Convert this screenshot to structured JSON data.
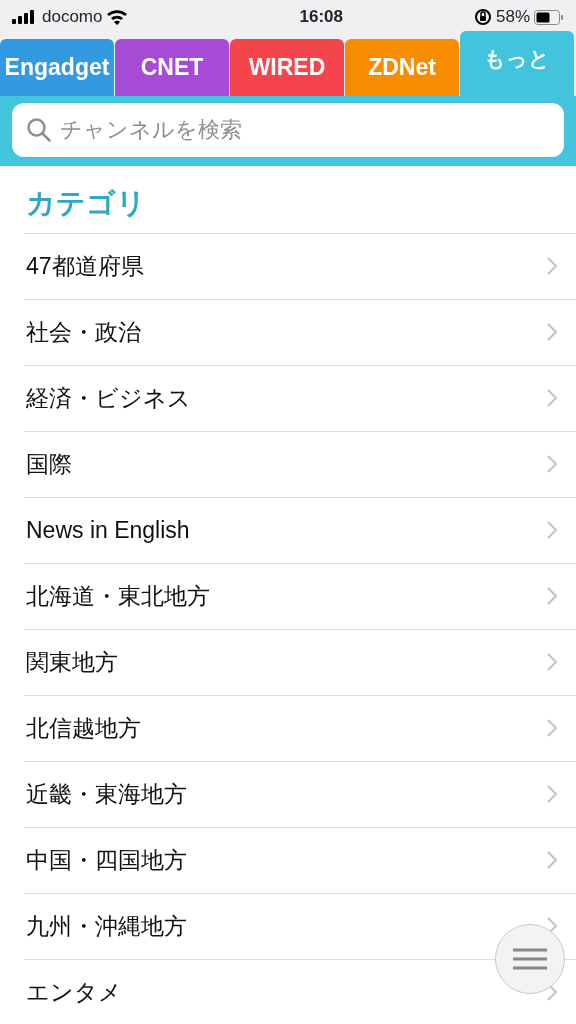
{
  "status_bar": {
    "carrier": "docomo",
    "time": "16:08",
    "battery": "58%"
  },
  "tabs": [
    {
      "label": "Engadget",
      "color": "#3399e0",
      "selected": false
    },
    {
      "label": "CNET",
      "color": "#a64bd6",
      "selected": false
    },
    {
      "label": "WIRED",
      "color": "#f4444c",
      "selected": false
    },
    {
      "label": "ZDNet",
      "color": "#f78c00",
      "selected": false
    },
    {
      "label": "もっと",
      "color": "#42c4dc",
      "selected": true
    }
  ],
  "search": {
    "placeholder": "チャンネルを検索"
  },
  "section_title": "カテゴリ",
  "categories": [
    "47都道府県",
    "社会・政治",
    "経済・ビジネス",
    "国際",
    "News in English",
    "北海道・東北地方",
    "関東地方",
    "北信越地方",
    "近畿・東海地方",
    "中国・四国地方",
    "九州・沖縄地方",
    "エンタメ"
  ]
}
